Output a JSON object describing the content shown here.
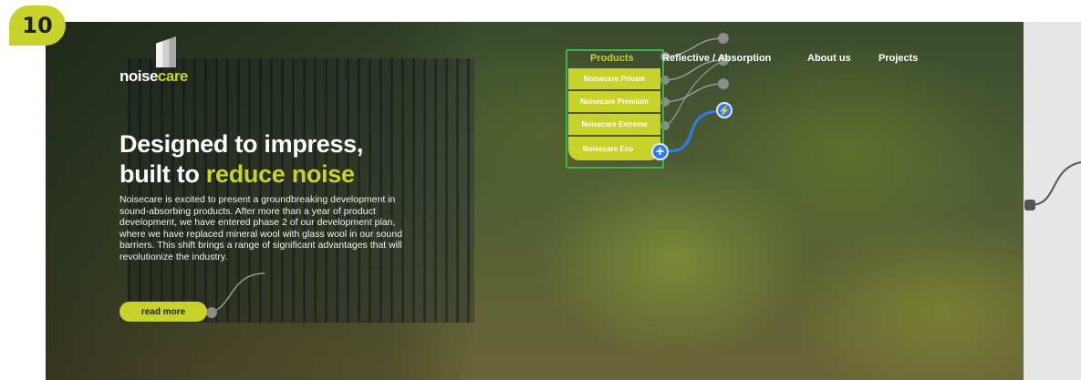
{
  "badge": {
    "number": "10"
  },
  "brand": {
    "logo_part1": "noise",
    "logo_part2": "care"
  },
  "nav": {
    "items": [
      {
        "label": "Products"
      },
      {
        "label": "Reflective / Absorption"
      },
      {
        "label": "About us"
      },
      {
        "label": "Projects"
      }
    ]
  },
  "products_menu": {
    "items": [
      {
        "label": "Noisecare Private"
      },
      {
        "label": "Noisecare Premium"
      },
      {
        "label": "Noisecare Extreme"
      },
      {
        "label": "Noisecare Eco"
      }
    ]
  },
  "hero": {
    "headline_line1": "Designed to impress,",
    "headline_line2_prefix": "built to ",
    "headline_line2_accent": "reduce noise",
    "body": "Noisecare is excited to present a groundbreaking development in sound-absorbing products. After more than a year of product development, we have entered phase 2 of our development plan, where we have replaced mineral wool with glass wool in our sound barriers. This shift brings a range of significant advantages that will revolutionize the industry.",
    "cta_label": "read more"
  },
  "controls": {
    "add_symbol": "+",
    "bolt_symbol": "⚡"
  },
  "colors": {
    "accent": "#c7d32a",
    "connector_blue": "#2e7cf0",
    "selection_outline": "#3bb54a"
  }
}
